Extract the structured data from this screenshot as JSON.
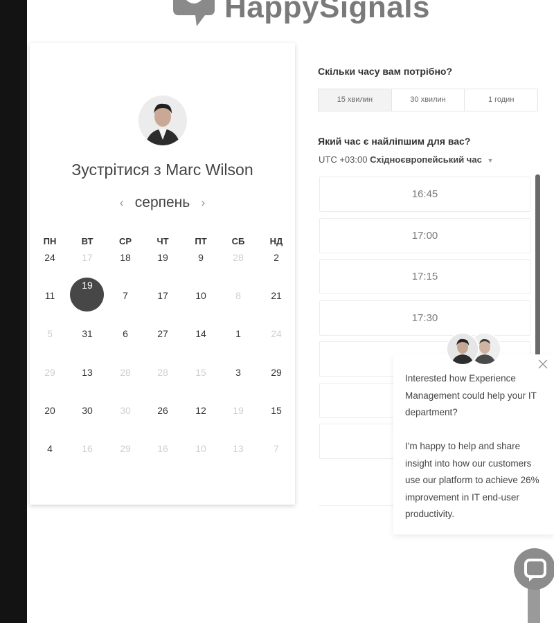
{
  "brand": {
    "name": "HappySignals"
  },
  "meeting": {
    "title": "Зустрітися з Marc Wilson"
  },
  "calendar": {
    "month": "серпень",
    "weekdays": [
      "ПН",
      "ВТ",
      "СР",
      "ЧТ",
      "ПТ",
      "СБ",
      "НД"
    ],
    "rows": [
      [
        {
          "d": "24",
          "m": false
        },
        {
          "d": "17",
          "m": true
        },
        {
          "d": "18",
          "m": false
        },
        {
          "d": "19",
          "m": false
        },
        {
          "d": "9",
          "m": false
        },
        {
          "d": "28",
          "m": true
        },
        {
          "d": "2",
          "m": false
        }
      ],
      [
        {
          "d": "11",
          "m": false
        },
        {
          "d": "19",
          "m": false,
          "s": true
        },
        {
          "d": "7",
          "m": false
        },
        {
          "d": "17",
          "m": false
        },
        {
          "d": "10",
          "m": false
        },
        {
          "d": "8",
          "m": true
        },
        {
          "d": "21",
          "m": false
        }
      ],
      [
        {
          "d": "5",
          "m": true
        },
        {
          "d": "31",
          "m": false
        },
        {
          "d": "6",
          "m": false
        },
        {
          "d": "27",
          "m": false
        },
        {
          "d": "14",
          "m": false
        },
        {
          "d": "1",
          "m": false
        },
        {
          "d": "24",
          "m": true
        }
      ],
      [
        {
          "d": "29",
          "m": true
        },
        {
          "d": "13",
          "m": false
        },
        {
          "d": "28",
          "m": true
        },
        {
          "d": "28",
          "m": true
        },
        {
          "d": "15",
          "m": true
        },
        {
          "d": "3",
          "m": false
        },
        {
          "d": "29",
          "m": false
        }
      ],
      [
        {
          "d": "20",
          "m": false
        },
        {
          "d": "30",
          "m": false
        },
        {
          "d": "30",
          "m": true
        },
        {
          "d": "26",
          "m": false
        },
        {
          "d": "12",
          "m": false
        },
        {
          "d": "19",
          "m": true
        },
        {
          "d": "15",
          "m": false
        }
      ],
      [
        {
          "d": "4",
          "m": false
        },
        {
          "d": "16",
          "m": true
        },
        {
          "d": "29",
          "m": true
        },
        {
          "d": "16",
          "m": true
        },
        {
          "d": "10",
          "m": true
        },
        {
          "d": "13",
          "m": true
        },
        {
          "d": "7",
          "m": true
        }
      ]
    ]
  },
  "duration": {
    "question": "Скільки часу вам потрібно?",
    "options": [
      "15 хвилин",
      "30 хвилин",
      "1 годин"
    ],
    "selected": "15 хвилин"
  },
  "time": {
    "question": "Який час є найліпшим для вас?",
    "tz_offset": "UTC +03:00",
    "tz_name": "Східноєвропейський час",
    "slots": [
      "16:45",
      "17:00",
      "17:15",
      "17:30",
      "",
      "",
      ""
    ]
  },
  "chat": {
    "message_1": "Interested how Experience Management could help your IT department?",
    "message_2": "I'm happy to help and share insight into how our customers use our platform to achieve 26% improvement in IT end-user productivity."
  }
}
